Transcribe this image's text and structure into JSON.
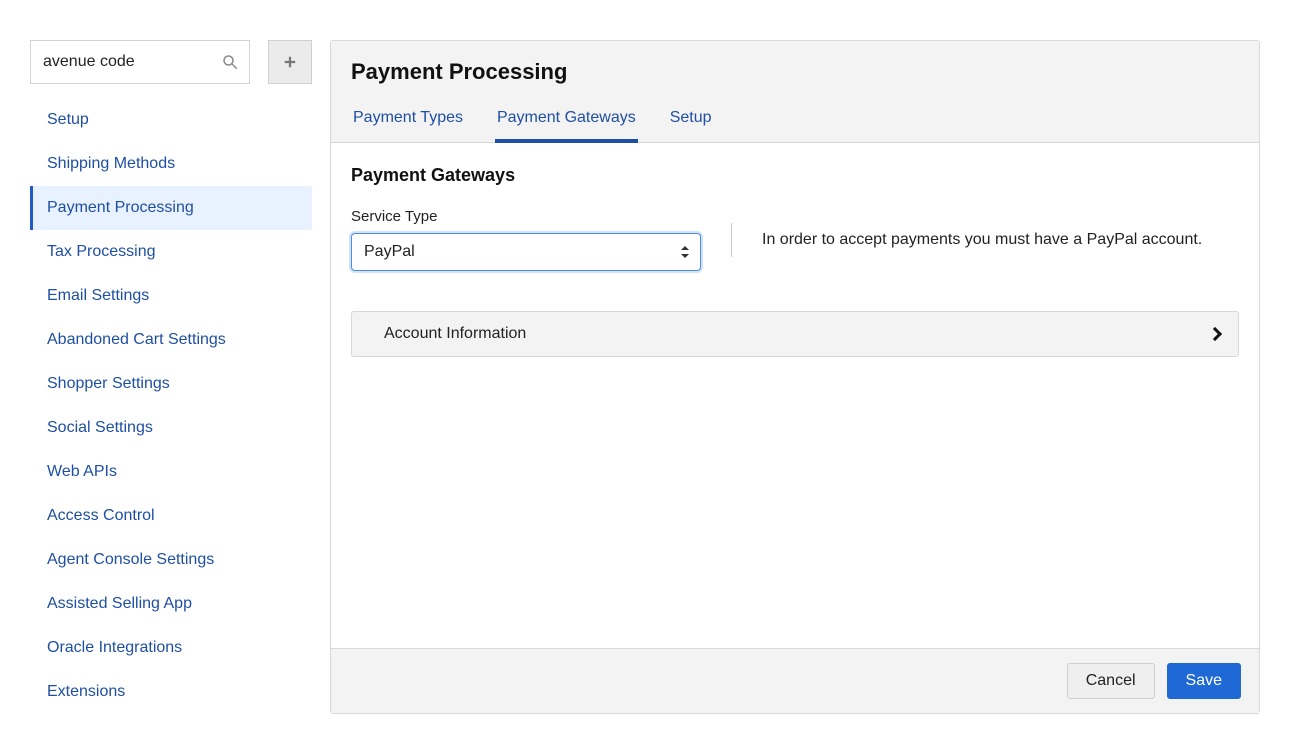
{
  "sidebar": {
    "search_value": "avenue code",
    "items": [
      {
        "label": "Setup"
      },
      {
        "label": "Shipping Methods"
      },
      {
        "label": "Payment Processing"
      },
      {
        "label": "Tax Processing"
      },
      {
        "label": "Email Settings"
      },
      {
        "label": "Abandoned Cart Settings"
      },
      {
        "label": "Shopper Settings"
      },
      {
        "label": "Social Settings"
      },
      {
        "label": "Web APIs"
      },
      {
        "label": "Access Control"
      },
      {
        "label": "Agent Console Settings"
      },
      {
        "label": "Assisted Selling App"
      },
      {
        "label": "Oracle Integrations"
      },
      {
        "label": "Extensions"
      }
    ],
    "active_index": 2,
    "add_button_title": "Add"
  },
  "panel": {
    "title": "Payment Processing",
    "tabs": [
      {
        "label": "Payment Types"
      },
      {
        "label": "Payment Gateways"
      },
      {
        "label": "Setup"
      }
    ],
    "active_tab_index": 1,
    "section_heading": "Payment Gateways",
    "service_type": {
      "label": "Service Type",
      "selected": "PayPal",
      "helper": "In order to accept payments you must have a PayPal account."
    },
    "accordion": {
      "title": "Account Information"
    },
    "buttons": {
      "cancel": "Cancel",
      "save": "Save"
    }
  }
}
